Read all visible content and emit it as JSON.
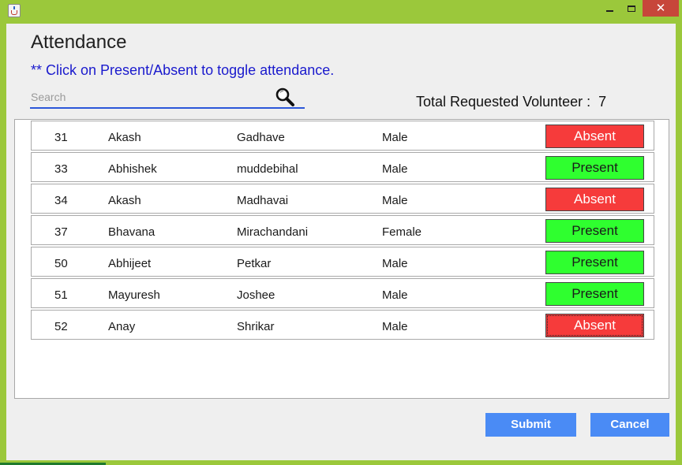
{
  "window": {
    "icon": "java-cup-icon",
    "controls": [
      "minimize-icon",
      "maximize-icon",
      "close-icon"
    ],
    "close_glyph": "✕"
  },
  "header": {
    "title": "Attendance",
    "instruction": "** Click on Present/Absent to toggle attendance."
  },
  "search": {
    "placeholder": "Search",
    "value": "",
    "icon": "search-icon"
  },
  "summary": {
    "text": "Total Requested Volunteer :  7"
  },
  "volunteers": [
    {
      "id": "31",
      "first_name": "Akash",
      "last_name": "Gadhave",
      "gender": "Male",
      "status": "Absent"
    },
    {
      "id": "33",
      "first_name": "Abhishek",
      "last_name": "muddebihal",
      "gender": "Male",
      "status": "Present"
    },
    {
      "id": "34",
      "first_name": "Akash",
      "last_name": "Madhavai",
      "gender": "Male",
      "status": "Absent"
    },
    {
      "id": "37",
      "first_name": "Bhavana",
      "last_name": "Mirachandani",
      "gender": "Female",
      "status": "Present"
    },
    {
      "id": "50",
      "first_name": "Abhijeet",
      "last_name": "Petkar",
      "gender": "Male",
      "status": "Present"
    },
    {
      "id": "51",
      "first_name": "Mayuresh",
      "last_name": "Joshee",
      "gender": "Male",
      "status": "Present"
    },
    {
      "id": "52",
      "first_name": "Anay",
      "last_name": "Shrikar",
      "gender": "Male",
      "status": "Absent"
    }
  ],
  "buttons": {
    "submit": "Submit",
    "cancel": "Cancel"
  },
  "colors": {
    "window_frame": "#9bc83b",
    "absent": "#f63b3b",
    "present": "#2fff2f",
    "action_button": "#4a8bf5",
    "instruction_text": "#1a1acd",
    "close_button": "#c7463a"
  }
}
